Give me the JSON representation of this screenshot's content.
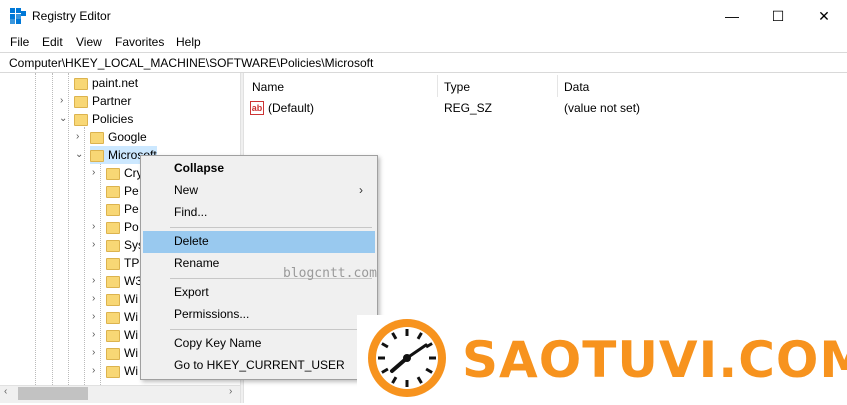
{
  "window": {
    "title": "Registry Editor",
    "minimize": "—",
    "maximize": "☐",
    "close": "✕"
  },
  "menu": [
    "File",
    "Edit",
    "View",
    "Favorites",
    "Help"
  ],
  "address": "Computer\\HKEY_LOCAL_MACHINE\\SOFTWARE\\Policies\\Microsoft",
  "tree": {
    "items": [
      "paint.net",
      "Partner",
      "Policies",
      "Google",
      "Microsoft",
      "Cry",
      "Pe",
      "Pe",
      "Po",
      "Sys",
      "TP",
      "W3",
      "Wi",
      "Wi",
      "Wi",
      "Wi",
      "Wi"
    ]
  },
  "list": {
    "headers": {
      "name": "Name",
      "type": "Type",
      "data": "Data"
    },
    "rows": [
      {
        "icon": "ab",
        "name": "(Default)",
        "type": "REG_SZ",
        "data": "(value not set)"
      }
    ]
  },
  "context_menu": {
    "items": [
      "Collapse",
      "New",
      "Find...",
      "Delete",
      "Rename",
      "Export",
      "Permissions...",
      "Copy Key Name",
      "Go to HKEY_CURRENT_USER"
    ],
    "highlighted": "Delete"
  },
  "watermark": "blogcntt.com",
  "logo": {
    "text": "SAOTUVI.COM",
    "color": "#f7931e"
  },
  "colors": {
    "highlight": "#99c9ef",
    "folder": "#f8d775",
    "accent": "#0078d7"
  }
}
